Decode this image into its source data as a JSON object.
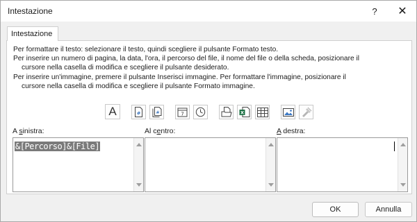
{
  "window": {
    "title": "Intestazione",
    "help_label": "?",
    "close_label": "✕"
  },
  "tab": {
    "label": "Intestazione"
  },
  "instructions": [
    "Per formattare il testo: selezionare il testo, quindi scegliere il pulsante Formato testo.",
    "Per inserire un numero di pagina, la data, l'ora, il percorso del file, il nome del file o della scheda, posizionare il",
    "cursore nella casella di modifica e scegliere il pulsante desiderato.",
    "Per inserire un'immagine, premere il pulsante Inserisci immagine. Per formattare l'immagine, posizionare il",
    "cursore nella casella di modifica e scegliere il pulsante Formato immagine."
  ],
  "toolbar": {
    "format_text_glyph": "A",
    "icons": [
      "format-text-icon",
      "page-number-icon",
      "page-count-icon",
      "date-icon",
      "time-icon",
      "file-path-icon",
      "file-name-icon",
      "sheet-name-icon",
      "insert-picture-icon",
      "format-picture-icon"
    ]
  },
  "sections": {
    "left": {
      "label_pre": "A ",
      "label_key": "s",
      "label_post": "inistra:",
      "value": "&[Percorso]&[File]"
    },
    "center": {
      "label_pre": "Al c",
      "label_key": "e",
      "label_post": "ntro:",
      "value": ""
    },
    "right": {
      "label_pre": "",
      "label_key": "A",
      "label_post": " destra:",
      "value": ""
    }
  },
  "buttons": {
    "ok": "OK",
    "cancel": "Annulla"
  }
}
